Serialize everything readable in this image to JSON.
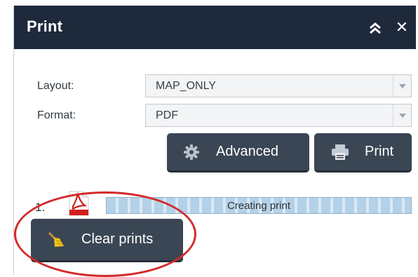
{
  "dialog": {
    "title": "Print",
    "collapse_icon": "double-chevron-up-icon",
    "close_icon": "close-icon",
    "close_glyph": "✕"
  },
  "form": {
    "layout_label": "Layout:",
    "layout_value": "MAP_ONLY",
    "format_label": "Format:",
    "format_value": "PDF"
  },
  "buttons": {
    "advanced_label": "Advanced",
    "advanced_icon": "gear-icon",
    "print_label": "Print",
    "print_icon": "printer-icon",
    "clear_label": "Clear prints",
    "clear_icon": "broom-icon"
  },
  "print_jobs": [
    {
      "index": "1.",
      "file_icon": "pdf-file-icon",
      "status": "Creating print"
    }
  ],
  "colors": {
    "titlebar": "#1e2a3b",
    "button": "#3b4654",
    "highlight_ring": "#d42a2a",
    "progress": "#b3d1e8"
  }
}
